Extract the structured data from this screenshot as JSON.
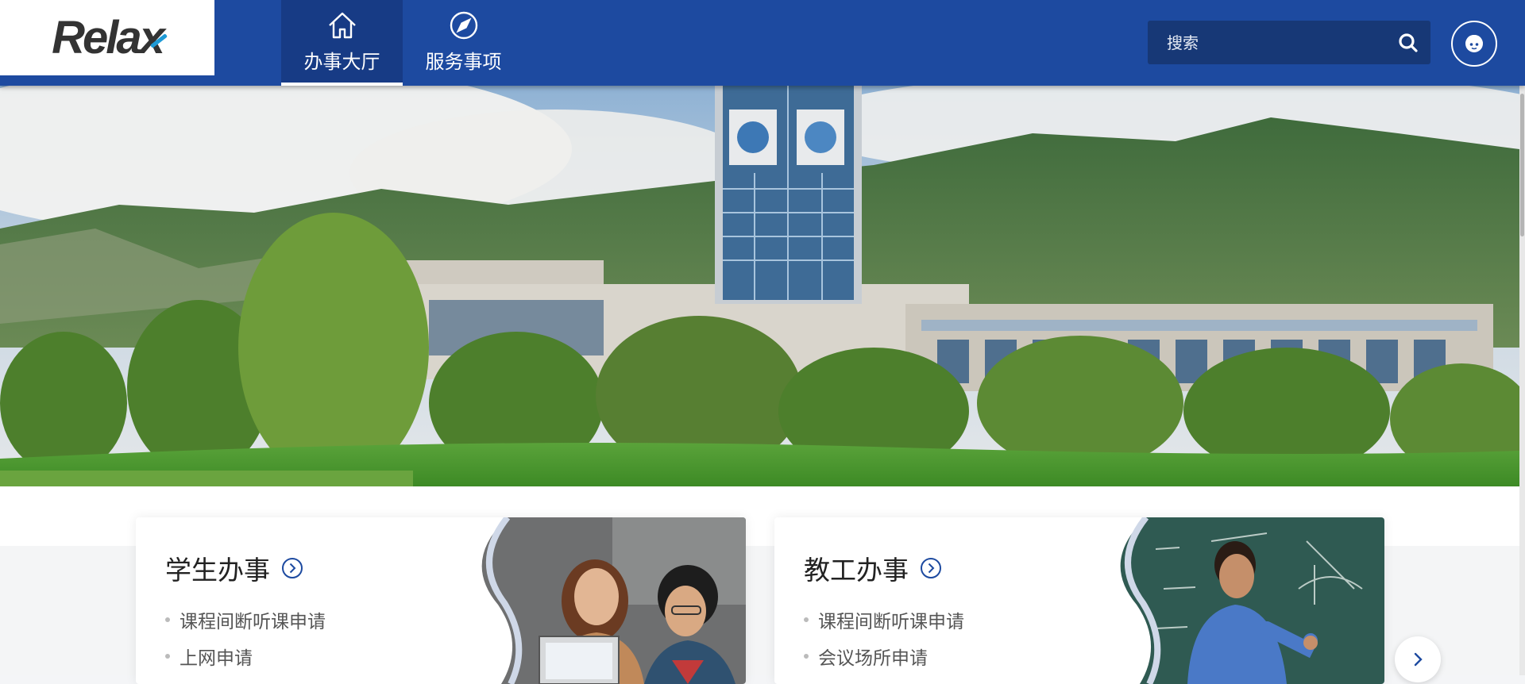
{
  "logo": {
    "text_main": "Rela",
    "text_x": "x",
    "accent": "#1e9ad6"
  },
  "nav": [
    {
      "label": "办事大厅",
      "icon": "home-icon",
      "active": true
    },
    {
      "label": "服务事项",
      "icon": "compass-icon",
      "active": false
    }
  ],
  "search": {
    "placeholder": "搜索",
    "icon": "search-icon"
  },
  "user": {
    "icon": "avatar-face-icon"
  },
  "colors": {
    "header": "#1d4aa0",
    "header_dark": "#173b85",
    "search_bg": "#173876",
    "link_icon": "#1d4aa0"
  },
  "cards": [
    {
      "title": "学生办事",
      "items": [
        "课程间断听课申请",
        "上网申请"
      ],
      "photo": "students-laughing-photo"
    },
    {
      "title": "教工办事",
      "items": [
        "课程间断听课申请",
        "会议场所申请"
      ],
      "photo": "teacher-blackboard-photo"
    }
  ],
  "carousel": {
    "next_icon": "chevron-right-icon"
  },
  "hero": {
    "photo": "campus-clocktower-mountains-photo"
  }
}
